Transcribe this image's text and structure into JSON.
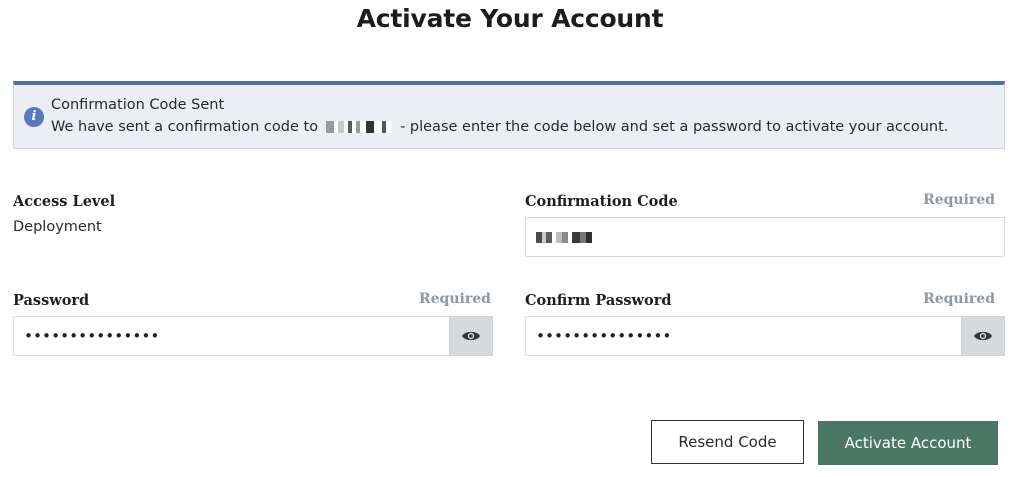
{
  "page": {
    "title": "Activate Your Account"
  },
  "alert": {
    "icon": "info-icon",
    "icon_glyph": "i",
    "title": "Confirmation Code Sent",
    "message_prefix": "We have sent a confirmation code to",
    "message_suffix": "- please enter the code below and set a password to activate your account.",
    "accent_color": "#4d6fb8"
  },
  "form": {
    "access_level": {
      "label": "Access Level",
      "value": "Deployment"
    },
    "confirmation_code": {
      "label": "Confirmation Code",
      "required": "Required"
    },
    "password": {
      "label": "Password",
      "required": "Required",
      "value": "•••••••••••••••"
    },
    "confirm_password": {
      "label": "Confirm Password",
      "required": "Required",
      "value": "•••••••••••••••"
    }
  },
  "actions": {
    "resend_label": "Resend Code",
    "activate_label": "Activate Account",
    "primary_color": "#4b7766"
  }
}
